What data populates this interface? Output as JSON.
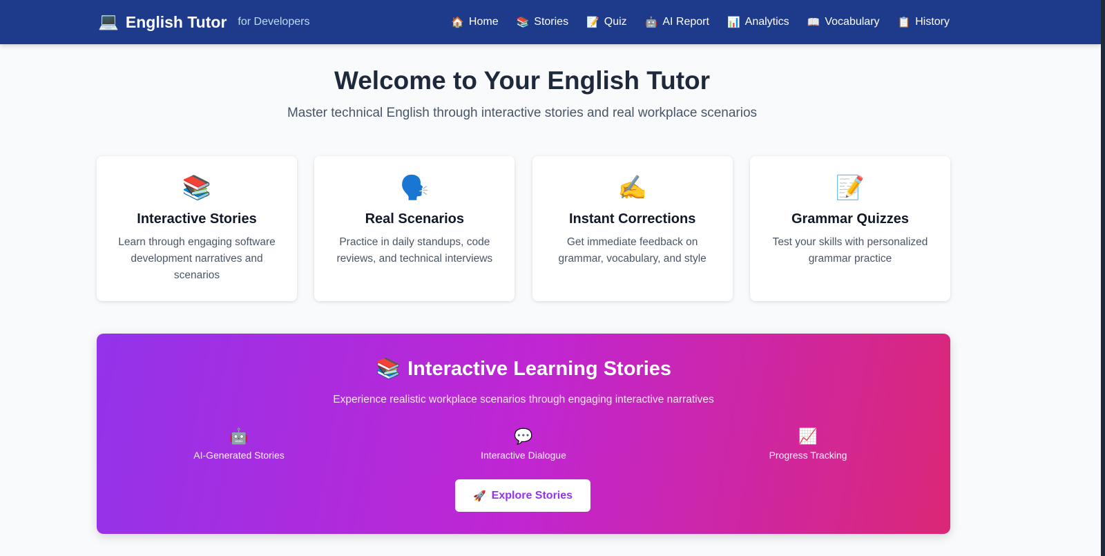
{
  "nav": {
    "brand_icon": "💻",
    "brand_title": "English Tutor",
    "brand_subtitle": "for Developers",
    "links": [
      {
        "icon": "🏠",
        "label": "Home"
      },
      {
        "icon": "📚",
        "label": "Stories"
      },
      {
        "icon": "📝",
        "label": "Quiz"
      },
      {
        "icon": "🤖",
        "label": "AI Report"
      },
      {
        "icon": "📊",
        "label": "Analytics"
      },
      {
        "icon": "📖",
        "label": "Vocabulary"
      },
      {
        "icon": "📋",
        "label": "History"
      }
    ]
  },
  "hero": {
    "title": "Welcome to Your English Tutor",
    "subtitle": "Master technical English through interactive stories and real workplace scenarios"
  },
  "cards": [
    {
      "icon": "📚",
      "title": "Interactive Stories",
      "desc": "Learn through engaging software development narratives and scenarios"
    },
    {
      "icon": "🗣️",
      "title": "Real Scenarios",
      "desc": "Practice in daily standups, code reviews, and technical interviews"
    },
    {
      "icon": "✍️",
      "title": "Instant Corrections",
      "desc": "Get immediate feedback on grammar, vocabulary, and style"
    },
    {
      "icon": "📝",
      "title": "Grammar Quizzes",
      "desc": "Test your skills with personalized grammar practice"
    }
  ],
  "banner": {
    "icon": "📚",
    "title": "Interactive Learning Stories",
    "subtitle": "Experience realistic workplace scenarios through engaging interactive narratives",
    "features": [
      {
        "icon": "🤖",
        "label": "AI-Generated Stories"
      },
      {
        "icon": "💬",
        "label": "Interactive Dialogue"
      },
      {
        "icon": "📈",
        "label": "Progress Tracking"
      }
    ],
    "button_icon": "🚀",
    "button_label": "Explore Stories"
  },
  "colors": {
    "navbar": "#1e3a8a",
    "background": "#f8fafc",
    "banner_start": "#9333ea",
    "banner_end": "#db2777",
    "button_text": "#9333ea"
  }
}
